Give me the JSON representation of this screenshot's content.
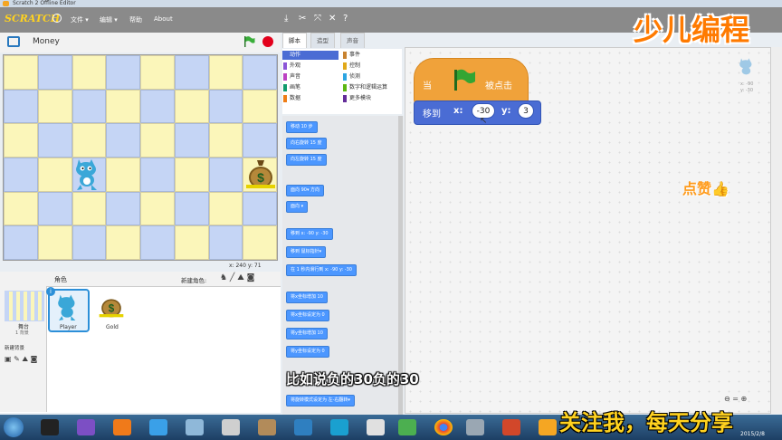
{
  "window": {
    "title": "Scratch 2 Offline Editor"
  },
  "menu": {
    "logo": "SCRATCH",
    "items": [
      "文件 ▾",
      "编辑 ▾",
      "帮助",
      "About"
    ]
  },
  "stage": {
    "project_title": "Money",
    "coords": "x: 240  y: 71"
  },
  "tabs": {
    "scripts": "脚本",
    "costumes": "造型",
    "sounds": "声音"
  },
  "categories": [
    {
      "label": "动作",
      "color": "#4a6cd4"
    },
    {
      "label": "事件",
      "color": "#c88330"
    },
    {
      "label": "外观",
      "color": "#8a55d7"
    },
    {
      "label": "控制",
      "color": "#e1a91a"
    },
    {
      "label": "声音",
      "color": "#bb42c3"
    },
    {
      "label": "侦测",
      "color": "#2ca5e2"
    },
    {
      "label": "画笔",
      "color": "#0e9a6c"
    },
    {
      "label": "数字和逻辑运算",
      "color": "#5cb712"
    },
    {
      "label": "数据",
      "color": "#ee7d16"
    },
    {
      "label": "更多模块",
      "color": "#632d99"
    }
  ],
  "palette": [
    "移动 10 步",
    "向右旋转 15 度",
    "向左旋转 15 度",
    "面向 90▾ 方向",
    "面向 ▾",
    "移到 x: -90 y: -30",
    "移到 鼠标指针▾",
    "在 1 秒内滑行到 x: -90 y: -30",
    "将x坐标增加 10",
    "将x坐标设定为 0",
    "将y坐标增加 10",
    "将y坐标设定为 0",
    "将旋转模式设定为 左-右翻转▾"
  ],
  "sprites": {
    "header": "角色",
    "new_label": "新建角色:",
    "stage_label": "舞台",
    "stage_sub": "1 背景",
    "new_backdrop": "新建背景",
    "items": [
      "Player",
      "Gold"
    ]
  },
  "script": {
    "hat_when": "当",
    "hat_clicked": "被点击",
    "move_label": "移到",
    "x_label": "x:",
    "x_value": "-30",
    "y_label": "y:",
    "y_value": "3"
  },
  "sprite_info": {
    "x": "x: -90",
    "y": "y: -30"
  },
  "overlays": {
    "brand": "少儿编程",
    "like": "点赞👍",
    "subtitle": "比如说负的30负的30",
    "follow": "关注我，每天分享"
  },
  "taskbar": {
    "date": "2015/2/8"
  },
  "colors": {
    "motion": "#4a6cd4",
    "events": "#f0a23a",
    "accent": "#ff7a00"
  }
}
